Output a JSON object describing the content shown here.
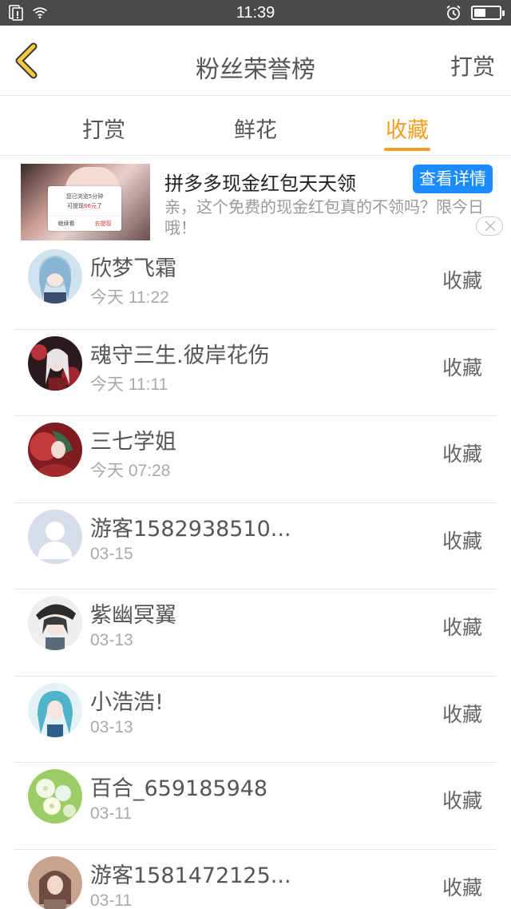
{
  "status_bar": {
    "time": "11:39"
  },
  "header": {
    "title": "粉丝荣誉榜",
    "right_action": "打赏"
  },
  "tabs": [
    {
      "label": "打赏",
      "active": false
    },
    {
      "label": "鲜花",
      "active": false
    },
    {
      "label": "收藏",
      "active": true
    }
  ],
  "accent_color": "#f0a020",
  "ad": {
    "headline": "拼多多现金红包天天领",
    "cta": "查看详情",
    "description": "亲，这个免费的现金红包真的不领吗？限今日哦！",
    "image_text": {
      "line1": "您已浏览5分钟",
      "line2_prefix": "可提现",
      "line2_amount": "66元",
      "line2_suffix": "了",
      "btn_left": "继续看",
      "btn_right": "去提现"
    }
  },
  "fans": [
    {
      "name": "欣梦飞霜",
      "time": "今天 11:22",
      "action": "收藏",
      "avatar": "avatar-anime-blue"
    },
    {
      "name": "魂守三生.彼岸花伤",
      "time": "今天 11:11",
      "action": "收藏",
      "avatar": "avatar-anime-red"
    },
    {
      "name": "三七学姐",
      "time": "今天 07:28",
      "action": "收藏",
      "avatar": "avatar-anime-crimson"
    },
    {
      "name": "游客1582938510...",
      "time": "03-15",
      "action": "收藏",
      "avatar": "avatar-default-user"
    },
    {
      "name": "紫幽冥翼",
      "time": "03-13",
      "action": "收藏",
      "avatar": "avatar-anime-dark"
    },
    {
      "name": "小浩浩!",
      "time": "03-13",
      "action": "收藏",
      "avatar": "avatar-anime-cyan"
    },
    {
      "name": "百合_659185948",
      "time": "03-11",
      "action": "收藏",
      "avatar": "avatar-lily-flower"
    },
    {
      "name": "游客1581472125...",
      "time": "03-11",
      "action": "收藏",
      "avatar": "avatar-anime-brown"
    }
  ]
}
